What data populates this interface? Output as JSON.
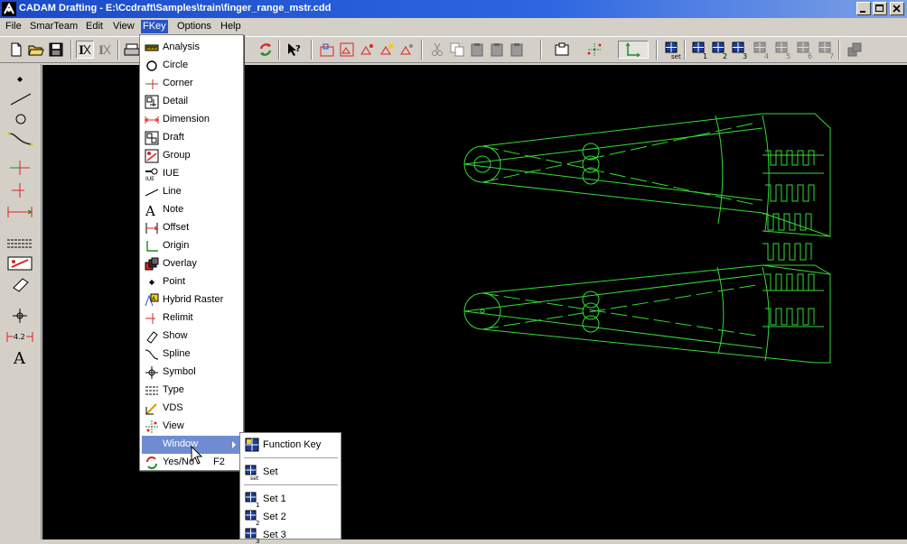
{
  "window": {
    "title": "CADAM Drafting - E:\\Ccdraft\\Samples\\train\\finger_range_mstr.cdd",
    "buttons": [
      "minimize",
      "maximize",
      "close"
    ]
  },
  "menubar": {
    "items": [
      {
        "label": "File"
      },
      {
        "label": "SmarTeam"
      },
      {
        "label": "Edit"
      },
      {
        "label": "View"
      },
      {
        "label": "FKey"
      },
      {
        "label": "Options"
      },
      {
        "label": "Help"
      }
    ],
    "active": "FKey"
  },
  "fkey_menu": {
    "items": [
      {
        "label": "Analysis",
        "icon": "analysis-icon"
      },
      {
        "label": "Circle",
        "icon": "circle-icon"
      },
      {
        "label": "Corner",
        "icon": "corner-icon"
      },
      {
        "label": "Detail",
        "icon": "detail-icon"
      },
      {
        "label": "Dimension",
        "icon": "dimension-icon"
      },
      {
        "label": "Draft",
        "icon": "draft-icon"
      },
      {
        "label": "Group",
        "icon": "group-icon"
      },
      {
        "label": "IUE",
        "icon": "iue-icon"
      },
      {
        "label": "Line",
        "icon": "line-icon"
      },
      {
        "label": "Note",
        "icon": "note-icon"
      },
      {
        "label": "Offset",
        "icon": "offset-icon"
      },
      {
        "label": "Origin",
        "icon": "origin-icon"
      },
      {
        "label": "Overlay",
        "icon": "overlay-icon"
      },
      {
        "label": "Point",
        "icon": "point-icon"
      },
      {
        "label": "Hybrid Raster",
        "icon": "hybrid-raster-icon"
      },
      {
        "label": "Relimit",
        "icon": "relimit-icon"
      },
      {
        "label": "Show",
        "icon": "show-icon"
      },
      {
        "label": "Spline",
        "icon": "spline-icon"
      },
      {
        "label": "Symbol",
        "icon": "symbol-icon"
      },
      {
        "label": "Type",
        "icon": "type-icon"
      },
      {
        "label": "VDS",
        "icon": "vds-icon"
      },
      {
        "label": "View",
        "icon": "view-icon"
      },
      {
        "label": "Window",
        "icon": "",
        "highlighted": true,
        "submenu": true
      },
      {
        "label": "Yes/No",
        "icon": "yes-no-icon",
        "shortcut": "F2"
      }
    ]
  },
  "window_submenu": {
    "items": [
      {
        "label": "Function Key",
        "icon": "function-key-icon"
      },
      {
        "label": "Set",
        "icon": "set-icon"
      },
      {
        "label": "Set 1",
        "icon": "set-1-icon"
      },
      {
        "label": "Set 2",
        "icon": "set-2-icon"
      },
      {
        "label": "Set 3",
        "icon": "set-3-icon"
      }
    ]
  },
  "toolbar": {
    "set_numbers": [
      "1",
      "2",
      "3",
      "4",
      "5",
      "6",
      "7"
    ],
    "set_label": "set"
  },
  "leftbar": {
    "dimension_value": "4.2",
    "note_glyph": "A"
  },
  "colors": {
    "canvas_background": "#000000",
    "geometry": "#33dd33",
    "menu_highlight": "#6f8cd3",
    "title_bar": "#1b4bc8"
  }
}
